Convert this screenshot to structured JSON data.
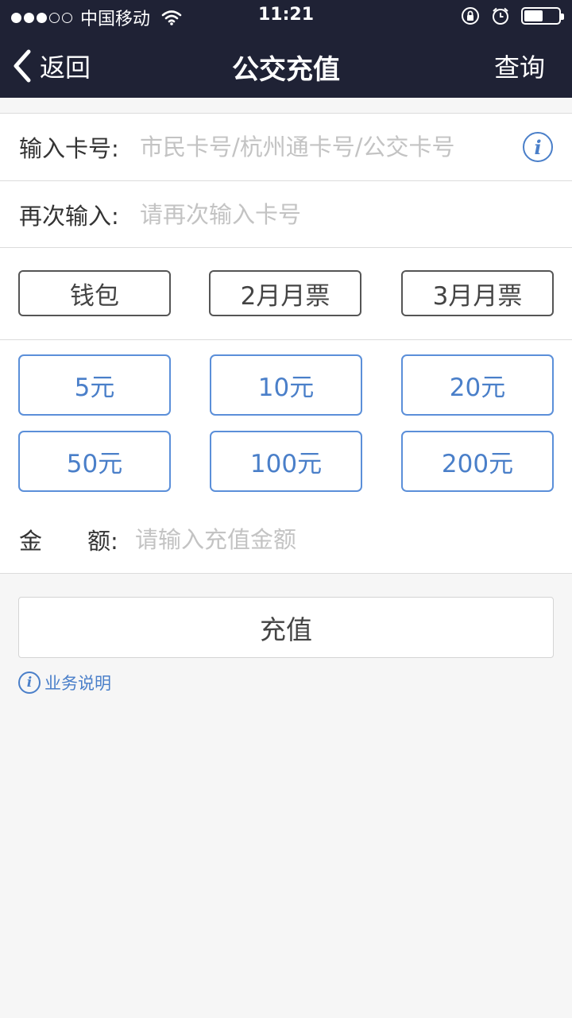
{
  "status_bar": {
    "carrier": "中国移动",
    "time": "11:21",
    "signal_dots_filled": 3,
    "signal_dots_total": 5,
    "battery_level": 0.55
  },
  "nav": {
    "back_label": "返回",
    "title": "公交充值",
    "query_label": "查询"
  },
  "form": {
    "card_label": "输入卡号:",
    "card_placeholder": "市民卡号/杭州通卡号/公交卡号",
    "confirm_label": "再次输入:",
    "confirm_placeholder": "请再次输入卡号",
    "amount_label_1": "金",
    "amount_label_2": "额:",
    "amount_placeholder": "请输入充值金额"
  },
  "types": [
    "钱包",
    "2月月票",
    "3月月票"
  ],
  "amounts": [
    "5元",
    "10元",
    "20元",
    "50元",
    "100元",
    "200元"
  ],
  "charge_button": "充值",
  "help_link": "业务说明",
  "colors": {
    "nav_bg": "#1f2235",
    "accent_blue": "#4a7fc9",
    "page_bg": "#f6f6f6"
  }
}
